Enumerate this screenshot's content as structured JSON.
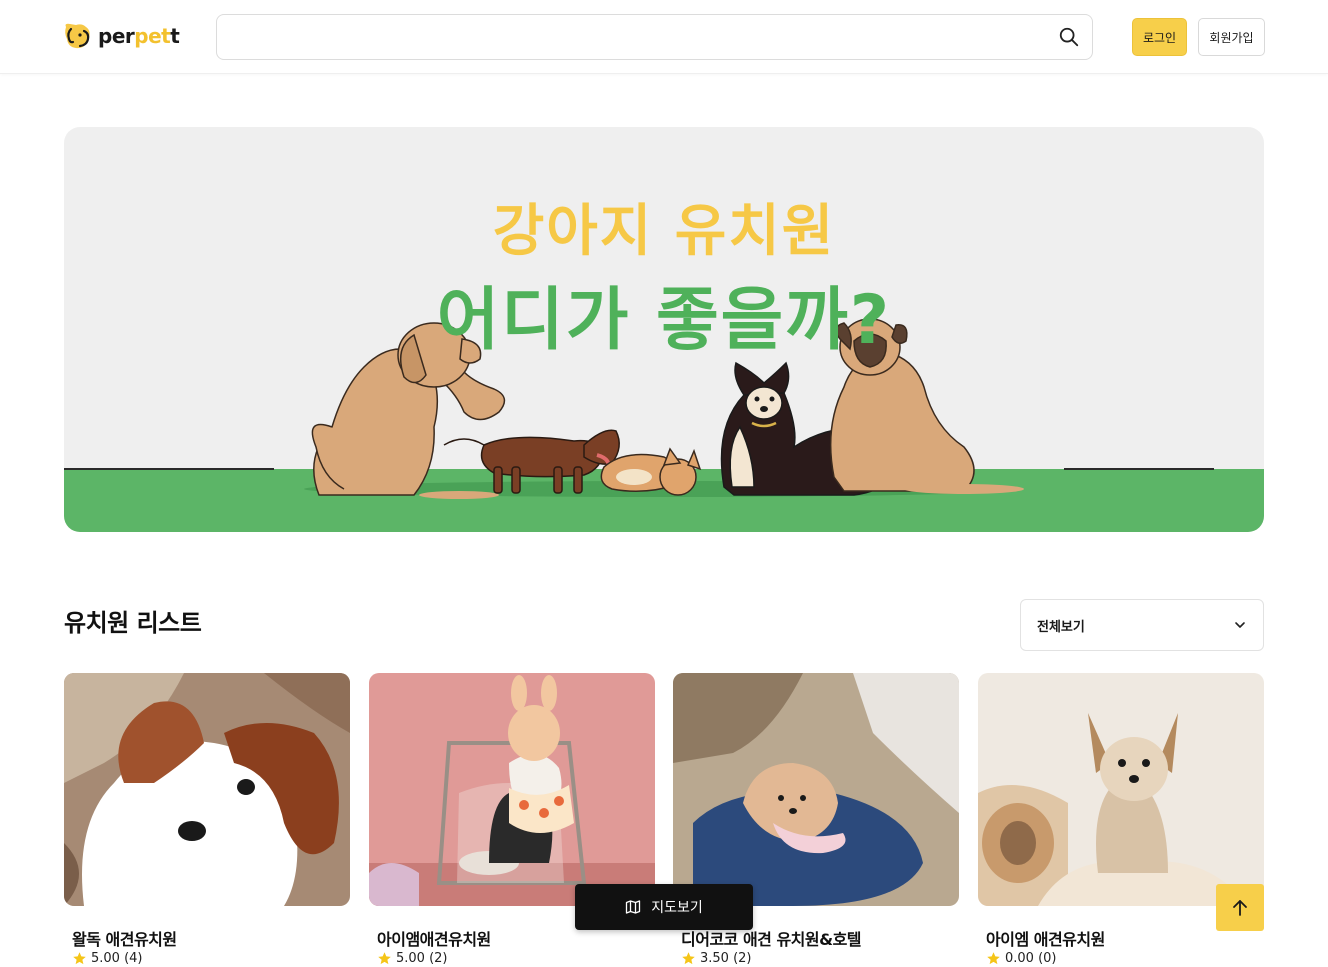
{
  "header": {
    "logo_text_a": "per",
    "logo_text_b": "pet",
    "logo_text_c": "t",
    "search_placeholder": "",
    "login_label": "로그인",
    "join_label": "회원가입"
  },
  "banner": {
    "line1": "강아지 유치원",
    "line2": "어디가 좋을까?"
  },
  "section": {
    "title": "유치원 리스트",
    "filter_value": "전체보기"
  },
  "cards": [
    {
      "name": "왈독 애견유치원",
      "rating": "5.00 (4)"
    },
    {
      "name": "아이앰애견유치원",
      "rating": "5.00 (2)"
    },
    {
      "name": "디어코코 애견 유치원&호텔",
      "rating": "3.50 (2)"
    },
    {
      "name": "아이엠 애견유치원",
      "rating": "0.00 (0)"
    }
  ],
  "floating": {
    "map_label": "지도보기"
  },
  "colors": {
    "accent_yellow": "#f7cf4a",
    "banner_green": "#4fb15a",
    "star": "#f5c518"
  },
  "icons": [
    "logo-icon",
    "search-icon",
    "chevron-down-icon",
    "star-icon",
    "map-icon",
    "arrow-up-icon"
  ]
}
